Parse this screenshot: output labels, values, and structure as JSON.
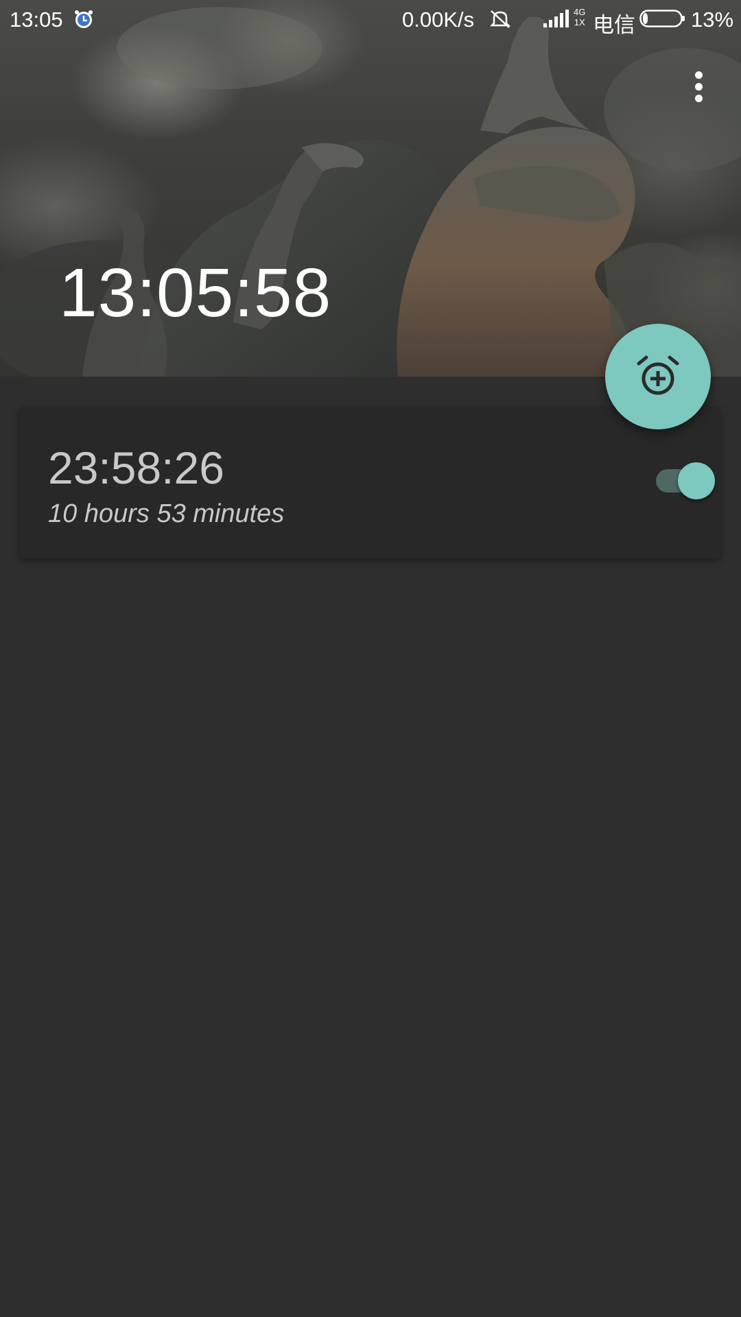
{
  "status_bar": {
    "time": "13:05",
    "net_speed": "0.00K/s",
    "network_type_top": "4G",
    "network_type_bottom": "1X",
    "carrier": "电信",
    "battery_percent": "13%",
    "battery_level": 0.13,
    "icons": [
      "alarm-icon",
      "mute-icon",
      "signal-icon",
      "battery-icon"
    ]
  },
  "header": {
    "current_time": "13:05:58",
    "menu_icon": "more-vert-icon"
  },
  "alarms": [
    {
      "time": "23:58:26",
      "remaining": "10 hours 53 minutes",
      "enabled": true
    }
  ],
  "fab": {
    "icon": "add-alarm-icon"
  },
  "colors": {
    "accent": "#7dc8bf",
    "background": "#2e2e2e",
    "card": "#282828",
    "secondary_text": "#c9c9c9"
  }
}
